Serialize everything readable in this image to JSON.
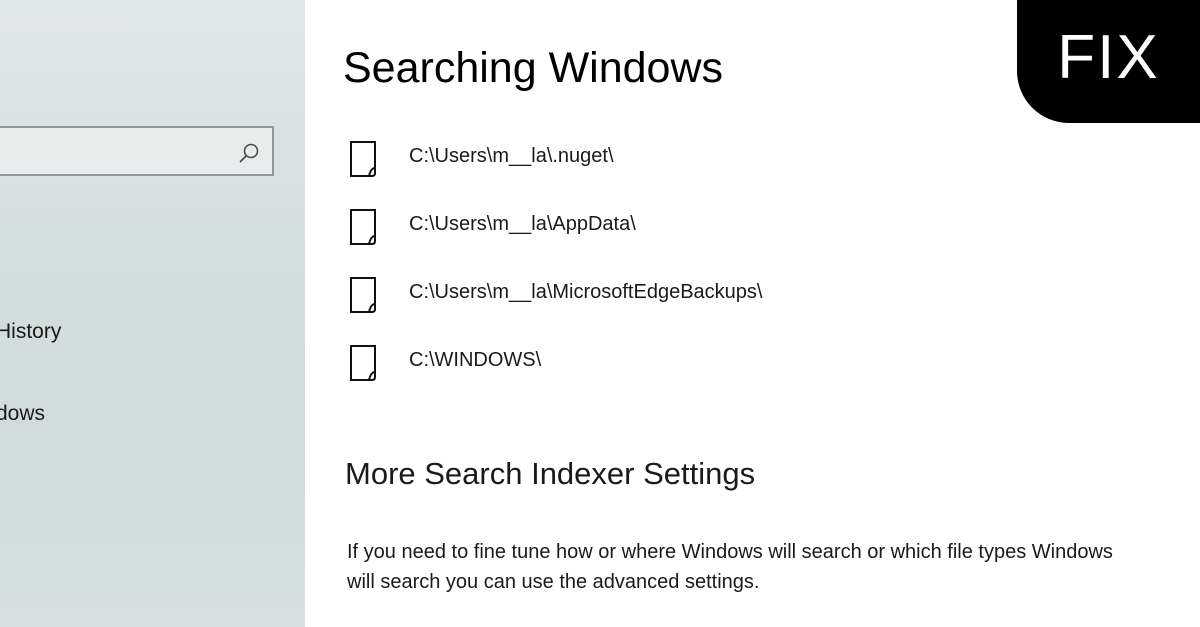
{
  "sidebar": {
    "items": [
      {
        "label": "History"
      },
      {
        "label": "dows"
      }
    ]
  },
  "main": {
    "title": "Searching Windows",
    "folders": [
      {
        "path": "C:\\Users\\m__la\\.nuget\\"
      },
      {
        "path": "C:\\Users\\m__la\\AppData\\"
      },
      {
        "path": "C:\\Users\\m__la\\MicrosoftEdgeBackups\\"
      },
      {
        "path": "C:\\WINDOWS\\"
      }
    ],
    "more_settings": {
      "heading": "More Search Indexer Settings",
      "description": "If you need to fine tune how or where Windows will search or which file types Windows will search you can use the advanced settings."
    }
  },
  "badge": {
    "text": "FIX"
  },
  "icons": {
    "search": "search-icon",
    "folder": "file-icon"
  }
}
